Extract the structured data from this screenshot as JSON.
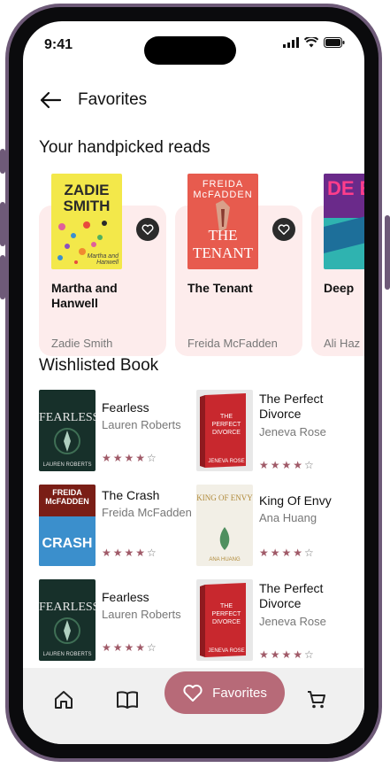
{
  "status_bar": {
    "time": "9:41"
  },
  "header": {
    "title": "Favorites"
  },
  "handpicked": {
    "title": "Your handpicked reads",
    "books": [
      {
        "title": "Martha and Hanwell",
        "author": "Zadie Smith",
        "cover_text": "ZADIE SMITH",
        "cover_sub": "Martha and Hanwell"
      },
      {
        "title": "The Tenant",
        "author": "Freida McFadden",
        "cover_text": "FREIDA McFADDEN",
        "cover_sub": "THE TENANT"
      },
      {
        "title": "Deep",
        "author": "Ali Haz",
        "cover_text": "DE E",
        "cover_sub": ""
      }
    ]
  },
  "wishlist": {
    "title": "Wishlisted Book",
    "books": [
      {
        "title": "Fearless",
        "author": "Lauren Roberts",
        "rating": 4,
        "cover_text": "FEARLESS",
        "cover_sub": "LAUREN ROBERTS"
      },
      {
        "title": "The Perfect Divorce",
        "author": "Jeneva Rose",
        "rating": 4,
        "cover_text": "THE PERFECT DIVORCE",
        "cover_sub": "JENEVA ROSE"
      },
      {
        "title": "The Crash",
        "author": "Freida McFadden",
        "rating": 4,
        "cover_text": "FREIDA McFADDEN",
        "cover_sub": "CRASH"
      },
      {
        "title": "King Of Envy",
        "author": "Ana Huang",
        "rating": 4,
        "cover_text": "KING OF ENVY",
        "cover_sub": "ANA HUANG"
      },
      {
        "title": "Fearless",
        "author": "Lauren Roberts",
        "rating": 4,
        "cover_text": "FEARLESS",
        "cover_sub": "LAUREN ROBERTS"
      },
      {
        "title": "The Perfect Divorce",
        "author": "Jeneva Rose",
        "rating": 4,
        "cover_text": "THE PERFECT DIVORCE",
        "cover_sub": "JENEVA ROSE"
      }
    ]
  },
  "tabbar": {
    "favorites_label": "Favorites"
  },
  "colors": {
    "accent": "#b76a78",
    "card_bg": "#fdecec",
    "star": "#a05a68",
    "frame": "#6e5a78"
  },
  "icons": [
    "back-arrow-icon",
    "heart-icon",
    "home-icon",
    "book-icon",
    "cart-icon",
    "signal-icon",
    "wifi-icon",
    "battery-icon"
  ]
}
